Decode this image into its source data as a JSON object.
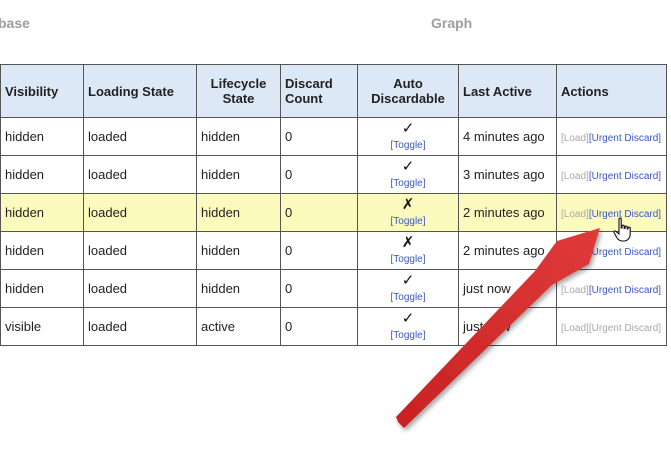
{
  "tabs": {
    "database": "base",
    "graph": "Graph"
  },
  "table": {
    "headers": {
      "visibility": "Visibility",
      "loading_state": "Loading State",
      "lifecycle_line1": "Lifecycle",
      "lifecycle_line2": "State",
      "discard_line1": "Discard",
      "discard_line2": "Count",
      "auto_line1": "Auto",
      "auto_line2": "Discardable",
      "last_active": "Last Active",
      "actions": "Actions"
    },
    "rows": [
      {
        "visibility": "hidden",
        "loading_state": "loaded",
        "lifecycle": "hidden",
        "discard_count": "0",
        "auto_mark": "✓",
        "toggle": "[Toggle]",
        "last_active": "4 minutes ago",
        "load": "[Load]",
        "discard": "[Urgent Discard]"
      },
      {
        "visibility": "hidden",
        "loading_state": "loaded",
        "lifecycle": "hidden",
        "discard_count": "0",
        "auto_mark": "✓",
        "toggle": "[Toggle]",
        "last_active": "3 minutes ago",
        "load": "[Load]",
        "discard": "[Urgent Discard]"
      },
      {
        "visibility": "hidden",
        "loading_state": "loaded",
        "lifecycle": "hidden",
        "discard_count": "0",
        "auto_mark": "✗",
        "toggle": "[Toggle]",
        "last_active": "2 minutes ago",
        "load": "[Load]",
        "discard": "[Urgent Discard]"
      },
      {
        "visibility": "hidden",
        "loading_state": "loaded",
        "lifecycle": "hidden",
        "discard_count": "0",
        "auto_mark": "✗",
        "toggle": "[Toggle]",
        "last_active": "2 minutes ago",
        "load": "[Load]",
        "discard": "[Urgent Discard]"
      },
      {
        "visibility": "hidden",
        "loading_state": "loaded",
        "lifecycle": "hidden",
        "discard_count": "0",
        "auto_mark": "✓",
        "toggle": "[Toggle]",
        "last_active": "just now",
        "load": "[Load]",
        "discard": "[Urgent Discard]"
      },
      {
        "visibility": "visible",
        "loading_state": "loaded",
        "lifecycle": "active",
        "discard_count": "0",
        "auto_mark": "✓",
        "toggle": "[Toggle]",
        "last_active": "just now",
        "load": "[Load]",
        "discard": "[Urgent Discard]"
      }
    ],
    "highlighted_row": 2,
    "disabled_discard_row": 5
  },
  "colors": {
    "header_bg": "#dde8f7",
    "highlight_bg": "#fcfbbd",
    "link_blue": "#3a56c4",
    "disabled_gray": "#a8a8a8",
    "arrow_red": "#d62c2c"
  },
  "icons": {
    "arrow": "red-arrow-annotation",
    "cursor": "hand-pointer-icon"
  }
}
